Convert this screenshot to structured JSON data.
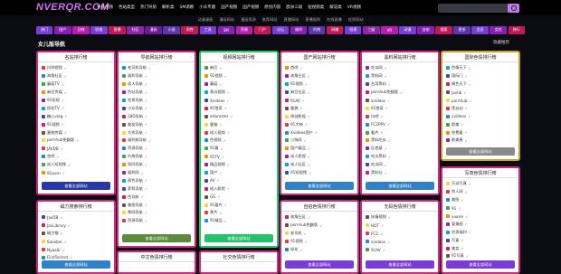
{
  "header": {
    "logo": "NVERQR.COM",
    "nav": [
      "导航视频",
      "色站类型",
      "热门导航",
      "解析类",
      "SM调教",
      "小众专题",
      "国产视频",
      "国产视频",
      "原创内容",
      "欧洲三级",
      "短视频类",
      "解说类",
      "VR视频"
    ],
    "search_placeholder": ""
  },
  "subnav": [
    "动漫漫画",
    "漫画网站",
    "漫画资源",
    "推荐网站",
    "直播网站",
    "直播福利",
    "在线直播",
    "优质网站"
  ],
  "categories": [
    {
      "label": "热门",
      "color": "#7a3bd6"
    },
    {
      "label": "国产",
      "color": "#8a1fb8"
    },
    {
      "label": "日韩",
      "color": "#b71cae"
    },
    {
      "label": "欧美",
      "color": "#7a3bd6"
    },
    {
      "label": "直播",
      "color": "#c2185b"
    },
    {
      "label": "社区",
      "color": "#8e24aa"
    },
    {
      "label": "漫画",
      "color": "#6a1b9a"
    },
    {
      "label": "小说",
      "color": "#5e35b1"
    },
    {
      "label": "同性",
      "color": "#c2185b"
    },
    {
      "label": "工具",
      "color": "#7a3bd6"
    },
    {
      "label": "SM",
      "color": "#8a1fb8"
    },
    {
      "label": "资源",
      "color": "#b71cae"
    },
    {
      "label": "门户",
      "color": "#c2185b"
    },
    {
      "label": "论坛",
      "color": "#7a3bd6"
    },
    {
      "label": "福利",
      "color": "#8a1fb8"
    },
    {
      "label": "约炮",
      "color": "#5e35b1"
    },
    {
      "label": "网赚",
      "color": "#c2185b"
    },
    {
      "label": "短视",
      "color": "#7a3bd6"
    },
    {
      "label": "三级",
      "color": "#8e24aa"
    },
    {
      "label": "VR",
      "color": "#b71cae"
    },
    {
      "label": "动漫",
      "color": "#7a3bd6"
    },
    {
      "label": "自拍",
      "color": "#8a1fb8"
    },
    {
      "label": "搜索",
      "color": "#c2185b"
    },
    {
      "label": "更多",
      "color": "#5e35b1"
    },
    {
      "label": "会员",
      "color": "#7a3bd6"
    },
    {
      "label": "女优",
      "color": "#8a1fb8"
    },
    {
      "label": "排行",
      "color": "#c2185b"
    }
  ],
  "page": {
    "title": "女儿版导航",
    "hide_link": "隐藏推荐"
  },
  "panels": [
    {
      "title": "名站排行榜",
      "border": "#d2297f",
      "btn": "查看全部网站",
      "btn_color": "#2838a8",
      "items": [
        "抖阴视频",
        "海角社区",
        "蘑菇TV",
        "麻豆传媒",
        "91短视",
        "探花TV",
        "糖心vlog",
        "91视频",
        "蜜桃传媒",
        "pornhub免翻版",
        "JAVDB",
        "杏吧",
        "成人短视频",
        "91porn"
      ]
    },
    {
      "title": "导航网站排行榜",
      "border": "#d2297f",
      "btn": "查看全部网站",
      "btn_color": "#5a8a3a",
      "items": [
        "老司机导航",
        "福利导航",
        "成人导航",
        "色站导航",
        "宅男导航",
        "小众导航",
        "18D导航",
        "美女导航",
        "大秀导航",
        "福利姬导航",
        "资源导航",
        "约炮导航",
        "男同导航",
        "福利网",
        "黄色导航",
        "萝莉导航",
        "色导航",
        "美图导航",
        "黄网导航",
        "资源导航"
      ]
    },
    {
      "title": "视频网站排行榜",
      "border": "#24c26b",
      "btn": "查看全部网站",
      "btn_color": "#24c26b",
      "items": [
        "麻豆",
        "91视频",
        "蘑菇",
        "黄瓜视频",
        "Xvideos",
        "91猎奇",
        "xHamster",
        "蜜柚",
        "成人视频",
        "色视频",
        "91看",
        "91TV",
        "精品视频",
        "国产",
        "AV",
        "成人影院",
        "GG",
        "91看片",
        "黄片",
        "91精品"
      ]
    },
    {
      "title": "国产网站排行榜",
      "border": "#d2297f",
      "btn": "查看全部网站",
      "btn_color": "#2f82c8",
      "items": [
        "杏吧",
        "海角社区",
        "91视频",
        "麻豆社区",
        "91AV",
        "蜜桃",
        "原创影视",
        "91大神",
        "Xvideos国产",
        "小狗网",
        "国产精品",
        "成人影视",
        "成人社区",
        "91短视频",
        "国产黄网",
        "18禁网"
      ]
    },
    {
      "title": "黑料网站排行榜",
      "border": "#d2297f",
      "btn": "查看全部网站",
      "btn_color": "#2f82c8",
      "items": [
        "吃瓜网",
        "黑料网",
        "台湾黑料",
        "pornhub免翻版",
        "xvideos",
        "91猎奇",
        "抖吧",
        "FC2PPV",
        "看片",
        "黑料吃瓜",
        "反差婊",
        "吃瓜黑料",
        "吃瓜网",
        "黑料社",
        "吃瓜群众",
        "明星黑料"
      ]
    },
    {
      "title": "国际色情排行榜",
      "border": "#c9a227",
      "btn": "查看全部网站",
      "btn_color": "#8a8a8a",
      "items": [
        "色情天下",
        "国际门",
        "情色天下",
        "Javlib",
        "pornhub",
        "黑丝站",
        "xvideos",
        "欧美",
        "免费看",
        "欧美黄",
        "老司机",
        "dmm",
        "亚洲"
      ]
    },
    {
      "title": "磁力搜索排行榜",
      "border": "#d2297f",
      "btn": "查看全部网站",
      "btn_color": "#2f82c8",
      "items": [
        "JavDB",
        "JavLibrary",
        "磁力猫",
        "Sukebei",
        "NyaaSi",
        "FindTorrent",
        "磁力搜"
      ]
    },
    {
      "title": "自拍色情排行榜",
      "border": "#d2297f",
      "btn": "查看全部网站",
      "btn_color": "#7a3bd6",
      "items": [
        "海角社区",
        "pornhub免翻版",
        "老司机",
        "91视频",
        "探花"
      ]
    },
    {
      "title": "无码色情排行榜",
      "border": "#d2297f",
      "btn": "查看全部网站",
      "btn_color": "#7a3bd6",
      "items": [
        "妖精视频",
        "HOT",
        "FC2",
        "xvideos",
        "91AV"
      ]
    },
    {
      "title": "写真色情排行榜",
      "border": "#d2297f",
      "btn": "查看全部网站",
      "btn_color": "#7a3bd6",
      "items": [
        "乐派写真",
        "秀人网",
        "美图",
        "91",
        "xiuren",
        "爱美图",
        "宅男福利",
        "写真",
        "美女",
        "91写真",
        "福利",
        "图片"
      ]
    },
    {
      "title": "中文色情排行榜",
      "border": "#d2297f",
      "items": []
    },
    {
      "title": "社交色情排行榜",
      "border": "#d2297f",
      "items": []
    }
  ]
}
